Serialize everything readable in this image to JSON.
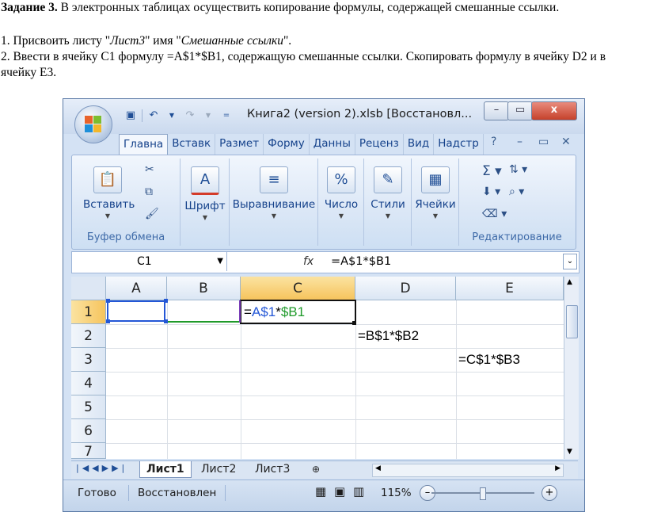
{
  "document": {
    "task_title": "Задание 3.",
    "task_text": " В электронных таблицах осуществить копирование формулы, содержащей смешанные ссылки.",
    "step1_prefix": "1. Присвоить листу \"",
    "step1_sheet": "Лист3",
    "step1_middle": "\" имя \"",
    "step1_name": "Смешанные ссылки",
    "step1_suffix": "\".",
    "step2": "2. Ввести в ячейку С1 формулу =А$1*$В1, содержащую смешанные ссылки. Скопировать формулу в ячейку D2 и в ячейку Е3."
  },
  "window": {
    "title": "Книга2 (version 2).xlsb [Восстановл...",
    "min_label": "–",
    "max_label": "▭",
    "close_label": "x"
  },
  "ribbon": {
    "tabs": [
      "Главна",
      "Вставк",
      "Размет",
      "Форму",
      "Данны",
      "Реценз",
      "Вид",
      "Надстр"
    ],
    "active_tab": 0,
    "paste_label": "Вставить",
    "clipboard_group": "Буфер обмена",
    "font_label": "Шрифт",
    "align_label": "Выравнивание",
    "number_label": "Число",
    "number_icon_text": "%",
    "styles_label": "Стили",
    "cells_label": "Ячейки",
    "editing_group": "Редактирование"
  },
  "formula_bar": {
    "name_box": "C1",
    "fx": "fx",
    "formula": "=A$1*$B1"
  },
  "grid": {
    "columns": [
      "A",
      "B",
      "C",
      "D",
      "E"
    ],
    "rows": [
      "1",
      "2",
      "3",
      "4",
      "5",
      "6",
      "7"
    ],
    "selected_column": "C",
    "selected_row": "1",
    "c1_eq": "=",
    "c1_a": "A$1",
    "c1_star": "*",
    "c1_b": "$B1",
    "d2": "=B$1*$B2",
    "e3": "=C$1*$B3",
    "colors": {
      "ref_a": "#2457d6",
      "ref_b": "#1f9a2a"
    }
  },
  "sheets": {
    "tabs": [
      "Лист1",
      "Лист2",
      "Лист3"
    ],
    "active": 0
  },
  "status": {
    "ready": "Готово",
    "recovered": "Восстановлен",
    "zoom": "115%"
  }
}
